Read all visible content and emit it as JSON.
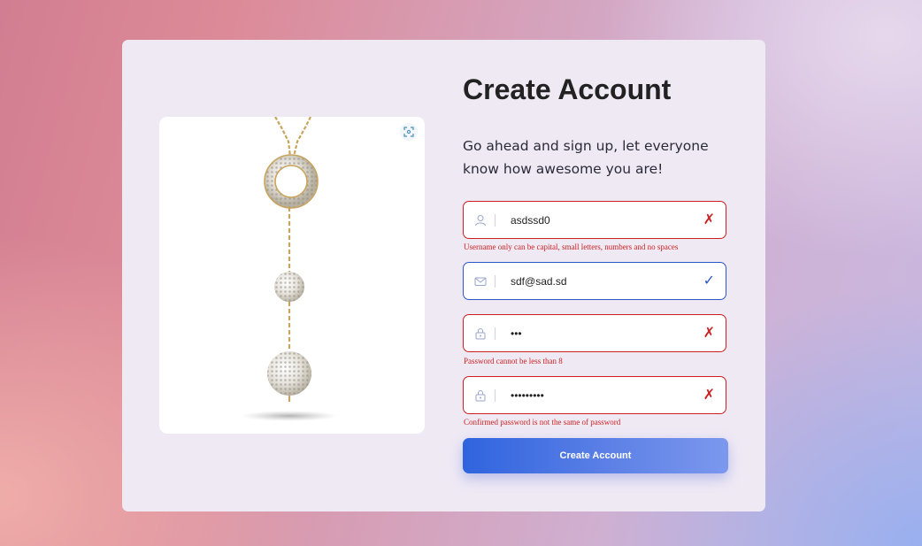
{
  "form": {
    "title": "Create Account",
    "subtitle": "Go ahead and sign up, let everyone know how awesome you are!",
    "fields": [
      {
        "name": "username",
        "icon": "user-icon",
        "value": "asdssd0",
        "status": "invalid",
        "status_glyph": "✗",
        "error": "Username only can be capital, small letters, numbers and no spaces"
      },
      {
        "name": "email",
        "icon": "mail-icon",
        "value": "sdf@sad.sd",
        "status": "valid",
        "status_glyph": "✓",
        "error": ""
      },
      {
        "name": "password",
        "icon": "lock-icon",
        "value": "abc",
        "status": "invalid",
        "status_glyph": "✗",
        "error": "Password cannot be less than 8"
      },
      {
        "name": "confirm_password",
        "icon": "lock-icon",
        "value": "abcdefghi",
        "status": "invalid",
        "status_glyph": "✗",
        "error": "Confirmed password is not the same of password"
      }
    ],
    "submit_label": "Create Account"
  },
  "colors": {
    "error": "#cc1f1f",
    "valid": "#2b58c6",
    "button_start": "#2f64de",
    "button_end": "#7c98ee",
    "card": "#efe9f4"
  },
  "image": {
    "subject": "gold necklace with crystal ring and two crystal ball pendants",
    "expand_icon": "expand-scan-icon"
  }
}
